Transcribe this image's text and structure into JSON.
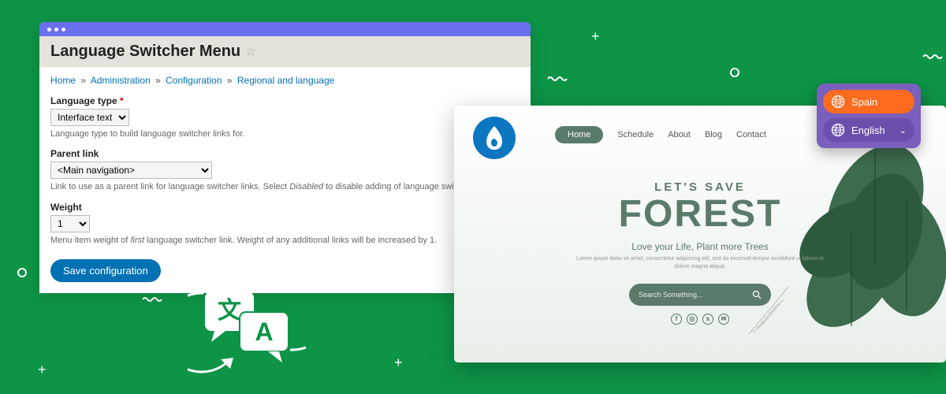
{
  "admin": {
    "title": "Language Switcher Menu",
    "breadcrumb": [
      "Home",
      "Administration",
      "Configuration",
      "Regional and language"
    ],
    "fields": {
      "language_type": {
        "label": "Language type",
        "required": true,
        "value": "Interface text",
        "help": "Language type to build language switcher links for."
      },
      "parent_link": {
        "label": "Parent link",
        "value": "<Main navigation>",
        "help_prefix": "Link to use as a parent link for language switcher links. Select ",
        "help_em": "Disabled",
        "help_suffix": " to disable adding of language switcher links."
      },
      "weight": {
        "label": "Weight",
        "value": "1",
        "help_prefix": "Menu item weight of ",
        "help_em": "first",
        "help_suffix": " language switcher link. Weight of any additional links will be increased by 1."
      }
    },
    "save_label": "Save configuration"
  },
  "site": {
    "nav": [
      "Home",
      "Schedule",
      "About",
      "Blog",
      "Contact"
    ],
    "hero_kicker": "LET'S SAVE",
    "hero_title": "FOREST",
    "hero_sub": "Love your Life, Plant more Trees",
    "hero_lorem": "Lorem ipsum dolor sit amet, consectetur adipiscing elit, sed do eiusmod tempor incididunt ut labore et dolore magna aliqua.",
    "search_placeholder": "Search Something..."
  },
  "lang_widget": {
    "options": [
      {
        "label": "Spain",
        "active": true
      },
      {
        "label": "English",
        "active": false
      }
    ]
  }
}
